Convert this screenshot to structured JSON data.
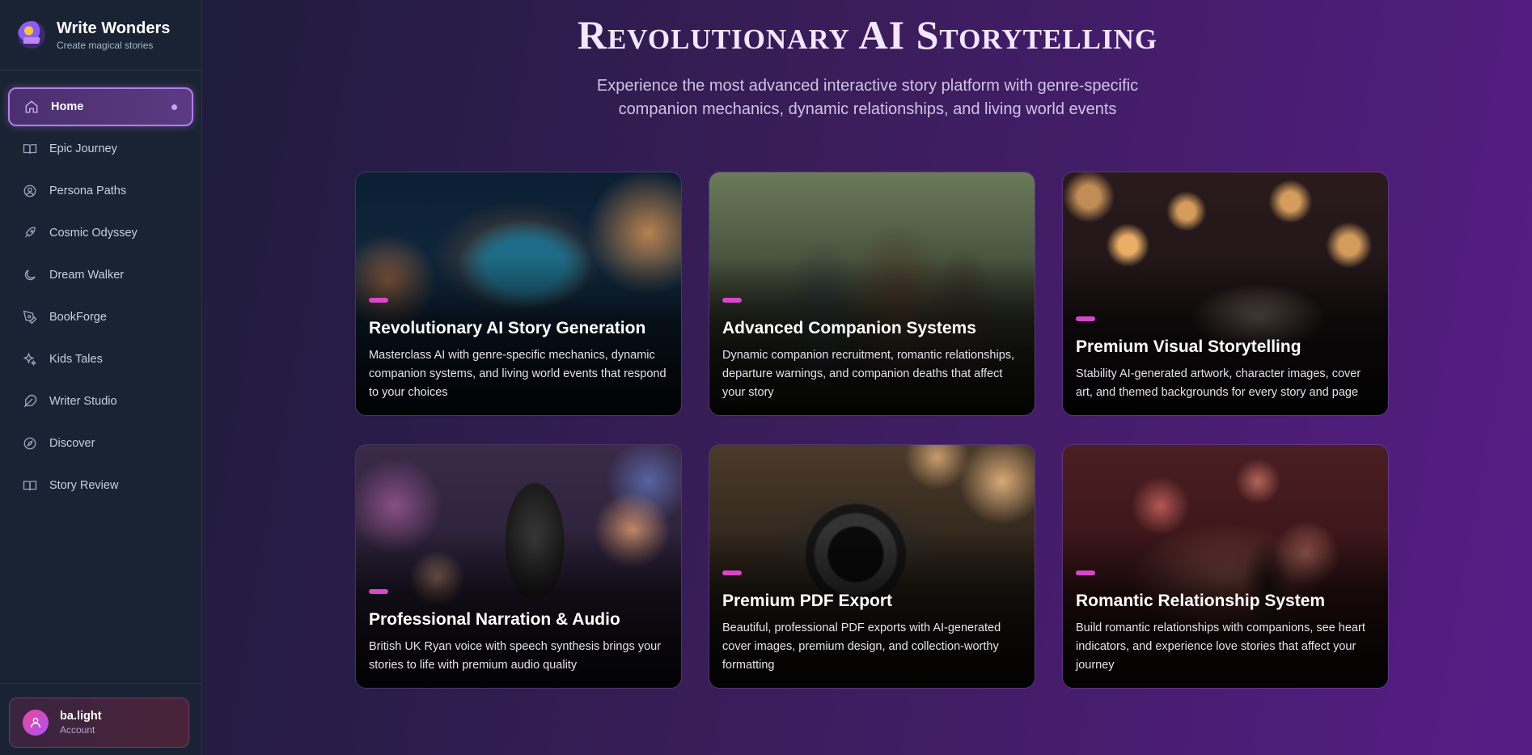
{
  "brand": {
    "title": "Write Wonders",
    "subtitle": "Create magical stories"
  },
  "sidebar": {
    "items": [
      {
        "label": "Home",
        "icon": "home-icon",
        "active": true
      },
      {
        "label": "Epic Journey",
        "icon": "book-open-icon"
      },
      {
        "label": "Persona Paths",
        "icon": "user-circle-icon"
      },
      {
        "label": "Cosmic Odyssey",
        "icon": "rocket-icon"
      },
      {
        "label": "Dream Walker",
        "icon": "moon-icon"
      },
      {
        "label": "BookForge",
        "icon": "pen-tool-icon"
      },
      {
        "label": "Kids Tales",
        "icon": "sparkles-icon"
      },
      {
        "label": "Writer Studio",
        "icon": "feather-icon"
      },
      {
        "label": "Discover",
        "icon": "compass-icon"
      },
      {
        "label": "Story Review",
        "icon": "book-open-icon"
      }
    ]
  },
  "account": {
    "name": "ba.light",
    "label": "Account",
    "icon": "user-icon"
  },
  "hero": {
    "title": "Revolutionary AI Storytelling",
    "subtitle_line1": "Experience the most advanced interactive story platform with genre-specific",
    "subtitle_line2": "companion mechanics, dynamic relationships, and living world events"
  },
  "features": [
    {
      "title": "Revolutionary AI Story Generation",
      "description": "Masterclass AI with genre-specific mechanics, dynamic companion systems, and living world events that respond to your choices"
    },
    {
      "title": "Advanced Companion Systems",
      "description": "Dynamic companion recruitment, romantic relationships, departure warnings, and companion deaths that affect your story"
    },
    {
      "title": "Premium Visual Storytelling",
      "description": "Stability AI-generated artwork, character images, cover art, and themed backgrounds for every story and page"
    },
    {
      "title": "Professional Narration & Audio",
      "description": "British UK Ryan voice with speech synthesis brings your stories to life with premium audio quality"
    },
    {
      "title": "Premium PDF Export",
      "description": "Beautiful, professional PDF exports with AI-generated cover images, premium design, and collection-worthy formatting"
    },
    {
      "title": "Romantic Relationship System",
      "description": "Build romantic relationships with companions, see heart indicators, and experience love stories that affect your journey"
    }
  ],
  "colors": {
    "accent": "#d946c9",
    "active_border": "#b57cf0",
    "sidebar_bg": "#1a2333"
  }
}
